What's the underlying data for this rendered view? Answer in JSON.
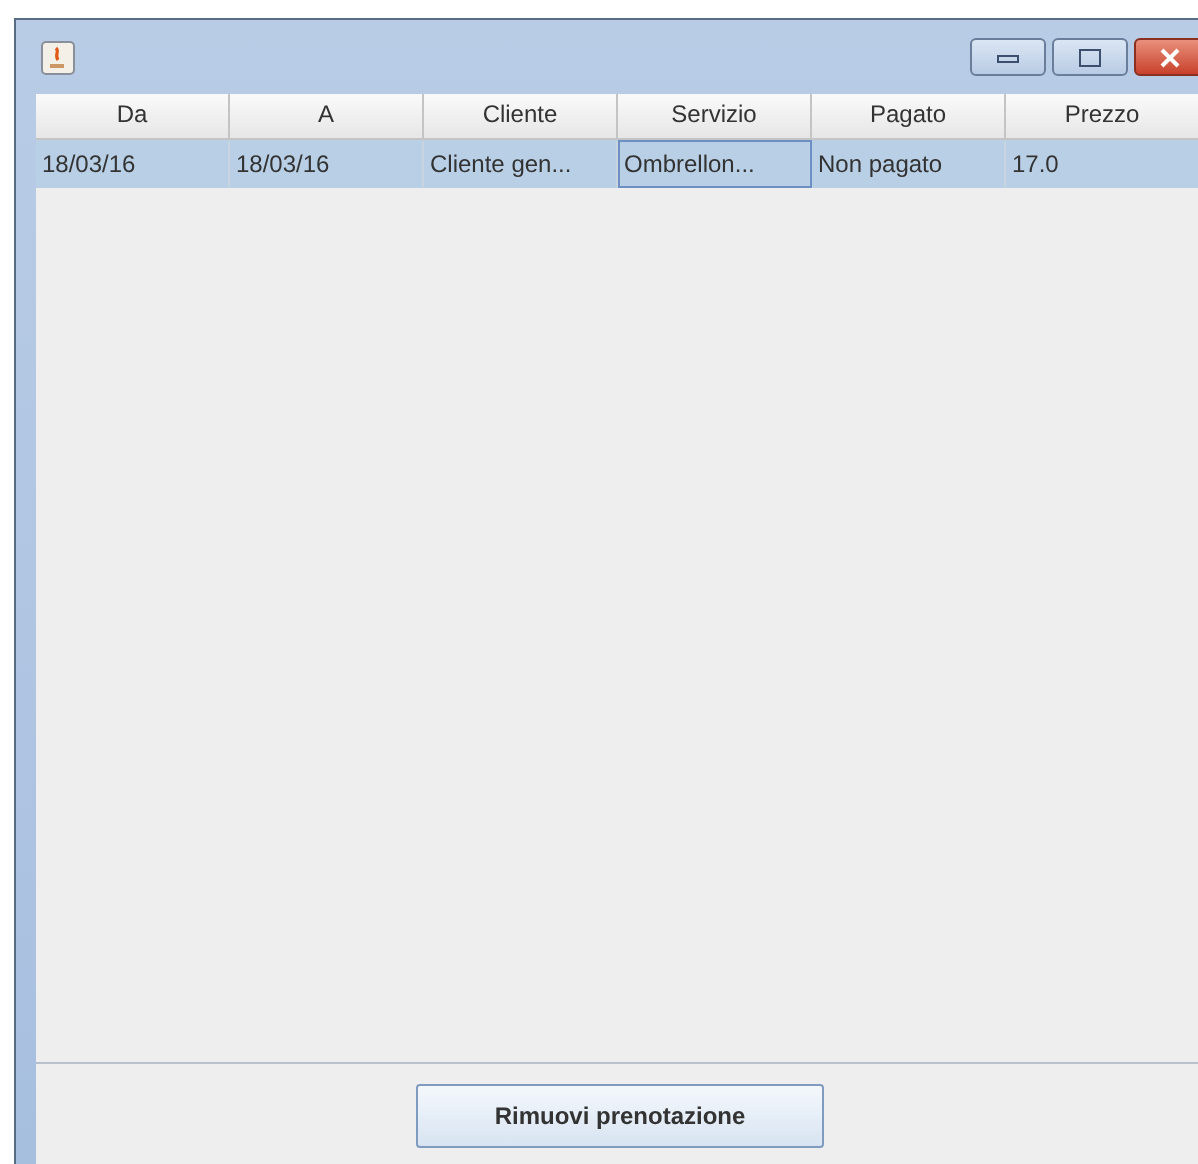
{
  "table": {
    "columns": [
      "Da",
      "A",
      "Cliente",
      "Servizio",
      "Pagato",
      "Prezzo"
    ],
    "rows": [
      {
        "selected": true,
        "cells": [
          {
            "text": "18/03/16",
            "focused": false
          },
          {
            "text": "18/03/16",
            "focused": false
          },
          {
            "text": "Cliente gen...",
            "focused": false
          },
          {
            "text": "Ombrellon...",
            "focused": true
          },
          {
            "text": "Non pagato",
            "focused": false
          },
          {
            "text": "17.0",
            "focused": false
          }
        ]
      }
    ]
  },
  "buttons": [
    "Rimuovi prenotazione"
  ]
}
